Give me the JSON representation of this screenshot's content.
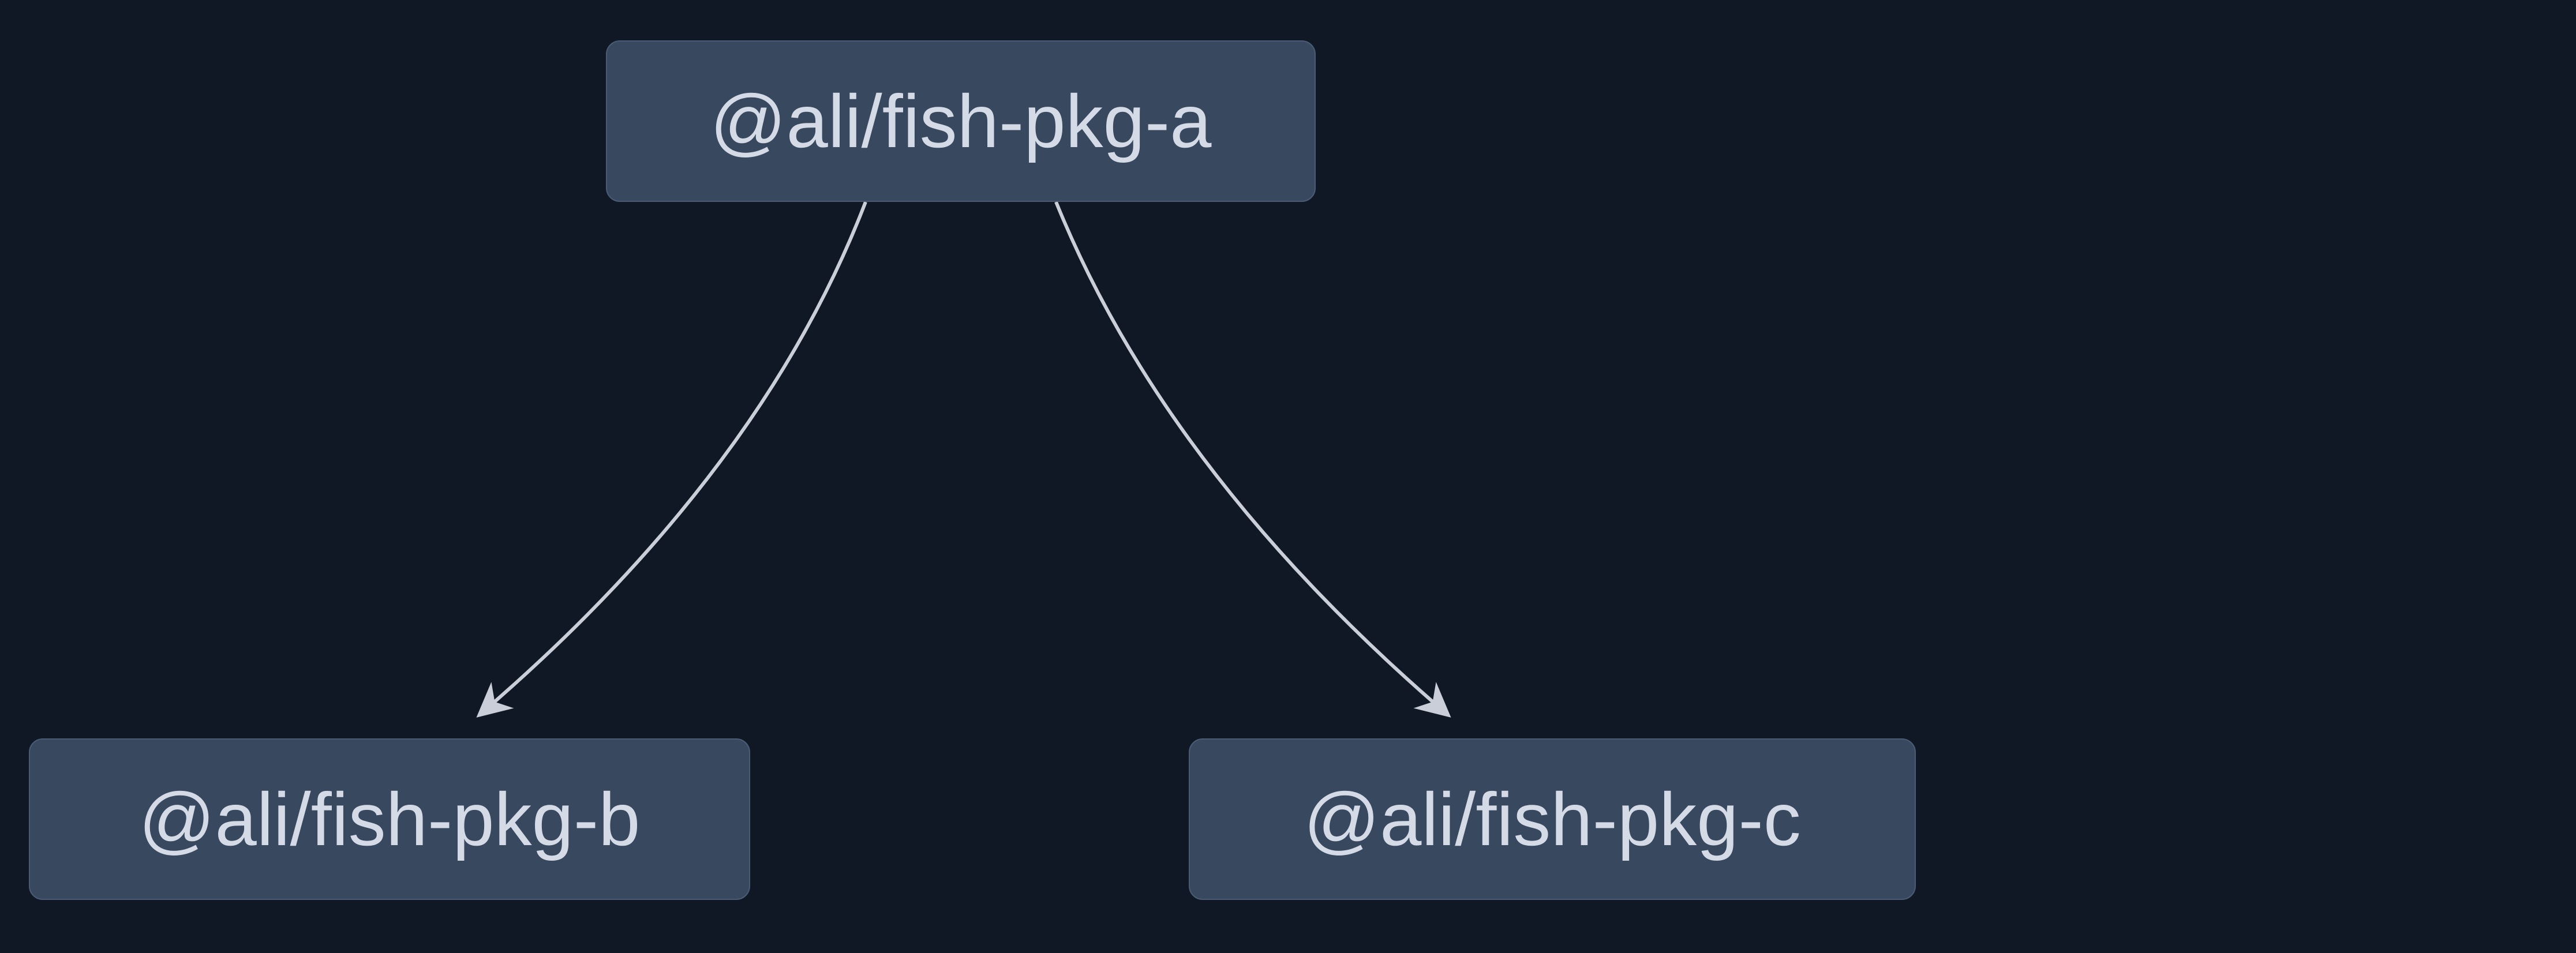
{
  "diagram": {
    "nodes": {
      "a": {
        "label": "@ali/fish-pkg-a"
      },
      "b": {
        "label": "@ali/fish-pkg-b"
      },
      "c": {
        "label": "@ali/fish-pkg-c"
      }
    },
    "edges": [
      {
        "from": "a",
        "to": "b"
      },
      {
        "from": "a",
        "to": "c"
      }
    ],
    "colors": {
      "background": "#0f1824",
      "node_fill": "#37485f",
      "node_border": "#4a5c74",
      "node_text": "#d5dbe6",
      "edge_stroke": "#c9ced8"
    }
  }
}
